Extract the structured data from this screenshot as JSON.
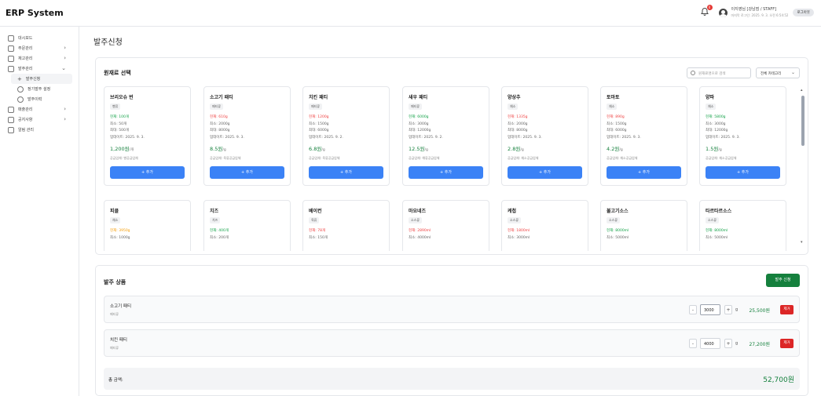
{
  "header": {
    "brand": "ERP System",
    "notification_count": "0",
    "user_name": "이지영님 [강남점 / STAFF]",
    "user_time": "마지막 로그인: 2025. 9. 3. 오전 6:54:52",
    "logout_label": "로그아웃"
  },
  "sidebar": {
    "items": [
      {
        "label": "대시보드"
      },
      {
        "label": "주문관리"
      },
      {
        "label": "재고관리"
      },
      {
        "label": "발주관리"
      },
      {
        "label": "발주신청"
      },
      {
        "label": "정기발주 설정"
      },
      {
        "label": "발주이력"
      },
      {
        "label": "매출관리"
      },
      {
        "label": "공지사항"
      },
      {
        "label": "알림 관리"
      }
    ]
  },
  "page": {
    "title": "발주신청"
  },
  "materials": {
    "title": "원재료 선택",
    "search_placeholder": "원재료명으로 검색",
    "category_select": "전체 카테고리",
    "cards": [
      {
        "name": "브리오슈 번",
        "category": "빵류",
        "current": "현재: 100개",
        "min": "최소: 50개",
        "max": "최대: 500개",
        "updated": "업데이트: 2025. 9. 3.",
        "price": "1,200원",
        "price_unit": "/개",
        "supplier": "공급업체: 빵공급업체",
        "add": "+ 추가"
      },
      {
        "name": "소고기 패티",
        "category": "패티류",
        "current": "현재: 610g",
        "min": "최소: 2000g",
        "max": "최대: 8000g",
        "updated": "업데이트: 2025. 9. 3.",
        "price": "8.5원",
        "price_unit": "/g",
        "supplier": "공급업체: 육류공급업체",
        "add": "+ 추가"
      },
      {
        "name": "치킨 패티",
        "category": "패티류",
        "current": "현재: 1200g",
        "min": "최소: 1500g",
        "max": "최대: 6000g",
        "updated": "업데이트: 2025. 9. 2.",
        "price": "6.8원",
        "price_unit": "/g",
        "supplier": "공급업체: 육류공급업체",
        "add": "+ 추가"
      },
      {
        "name": "새우 패티",
        "category": "패티류",
        "current": "현재: 6000g",
        "min": "최소: 3000g",
        "max": "최대: 12000g",
        "updated": "업데이트: 2025. 9. 2.",
        "price": "12.5원",
        "price_unit": "/g",
        "supplier": "공급업체: 해류공급업체",
        "add": "+ 추가"
      },
      {
        "name": "양상추",
        "category": "채소",
        "current": "현재: 1335g",
        "min": "최소: 2000g",
        "max": "최대: 8000g",
        "updated": "업데이트: 2025. 9. 3.",
        "price": "2.8원",
        "price_unit": "/g",
        "supplier": "공급업체: 채소공급업체",
        "add": "+ 추가"
      },
      {
        "name": "토마토",
        "category": "채소",
        "current": "현재: 890g",
        "min": "최소: 1500g",
        "max": "최대: 6000g",
        "updated": "업데이트: 2025. 9. 3.",
        "price": "4.2원",
        "price_unit": "/g",
        "supplier": "공급업체: 채소공급업체",
        "add": "+ 추가"
      },
      {
        "name": "양파",
        "category": "채소",
        "current": "현재: 5800g",
        "min": "최소: 3000g",
        "max": "최대: 12000g",
        "updated": "업데이트: 2025. 9. 3.",
        "price": "1.5원",
        "price_unit": "/g",
        "supplier": "공급업체: 채소공급업체",
        "add": "+ 추가"
      },
      {
        "name": "피클",
        "category": "채소",
        "current": "현재: 3950g",
        "min": "최소: 1000g"
      },
      {
        "name": "치즈",
        "category": "치즈",
        "current": "현재: 400개",
        "min": "최소: 200개"
      },
      {
        "name": "베이컨",
        "category": "육류",
        "current": "현재: 78개",
        "min": "최소: 150개"
      },
      {
        "name": "마요네즈",
        "category": "소스류",
        "current": "현재: 2890ml",
        "min": "최소: 4000ml"
      },
      {
        "name": "케첩",
        "category": "소스류",
        "current": "현재: 1800ml",
        "min": "최소: 3000ml"
      },
      {
        "name": "불고기소스",
        "category": "소스류",
        "current": "현재: 8000ml",
        "min": "최소: 5000ml"
      },
      {
        "name": "타르타르소스",
        "category": "소스류",
        "current": "현재: 8000ml",
        "min": "최소: 5000ml"
      }
    ]
  },
  "order": {
    "title": "발주 상품",
    "submit_label": "발주 신청",
    "items": [
      {
        "name": "소고기 패티",
        "category": "패티류",
        "qty": "3000",
        "unit": "g",
        "amount": "25,500원",
        "remove": "제거"
      },
      {
        "name": "치킨 패티",
        "category": "패티류",
        "qty": "4000",
        "unit": "g",
        "amount": "27,200원",
        "remove": "제거"
      }
    ],
    "total_label": "총 금액:",
    "total_value": "52,700원"
  },
  "colors": {
    "primary": "#3b82f6",
    "success": "#15803d",
    "danger": "#dc2626"
  }
}
